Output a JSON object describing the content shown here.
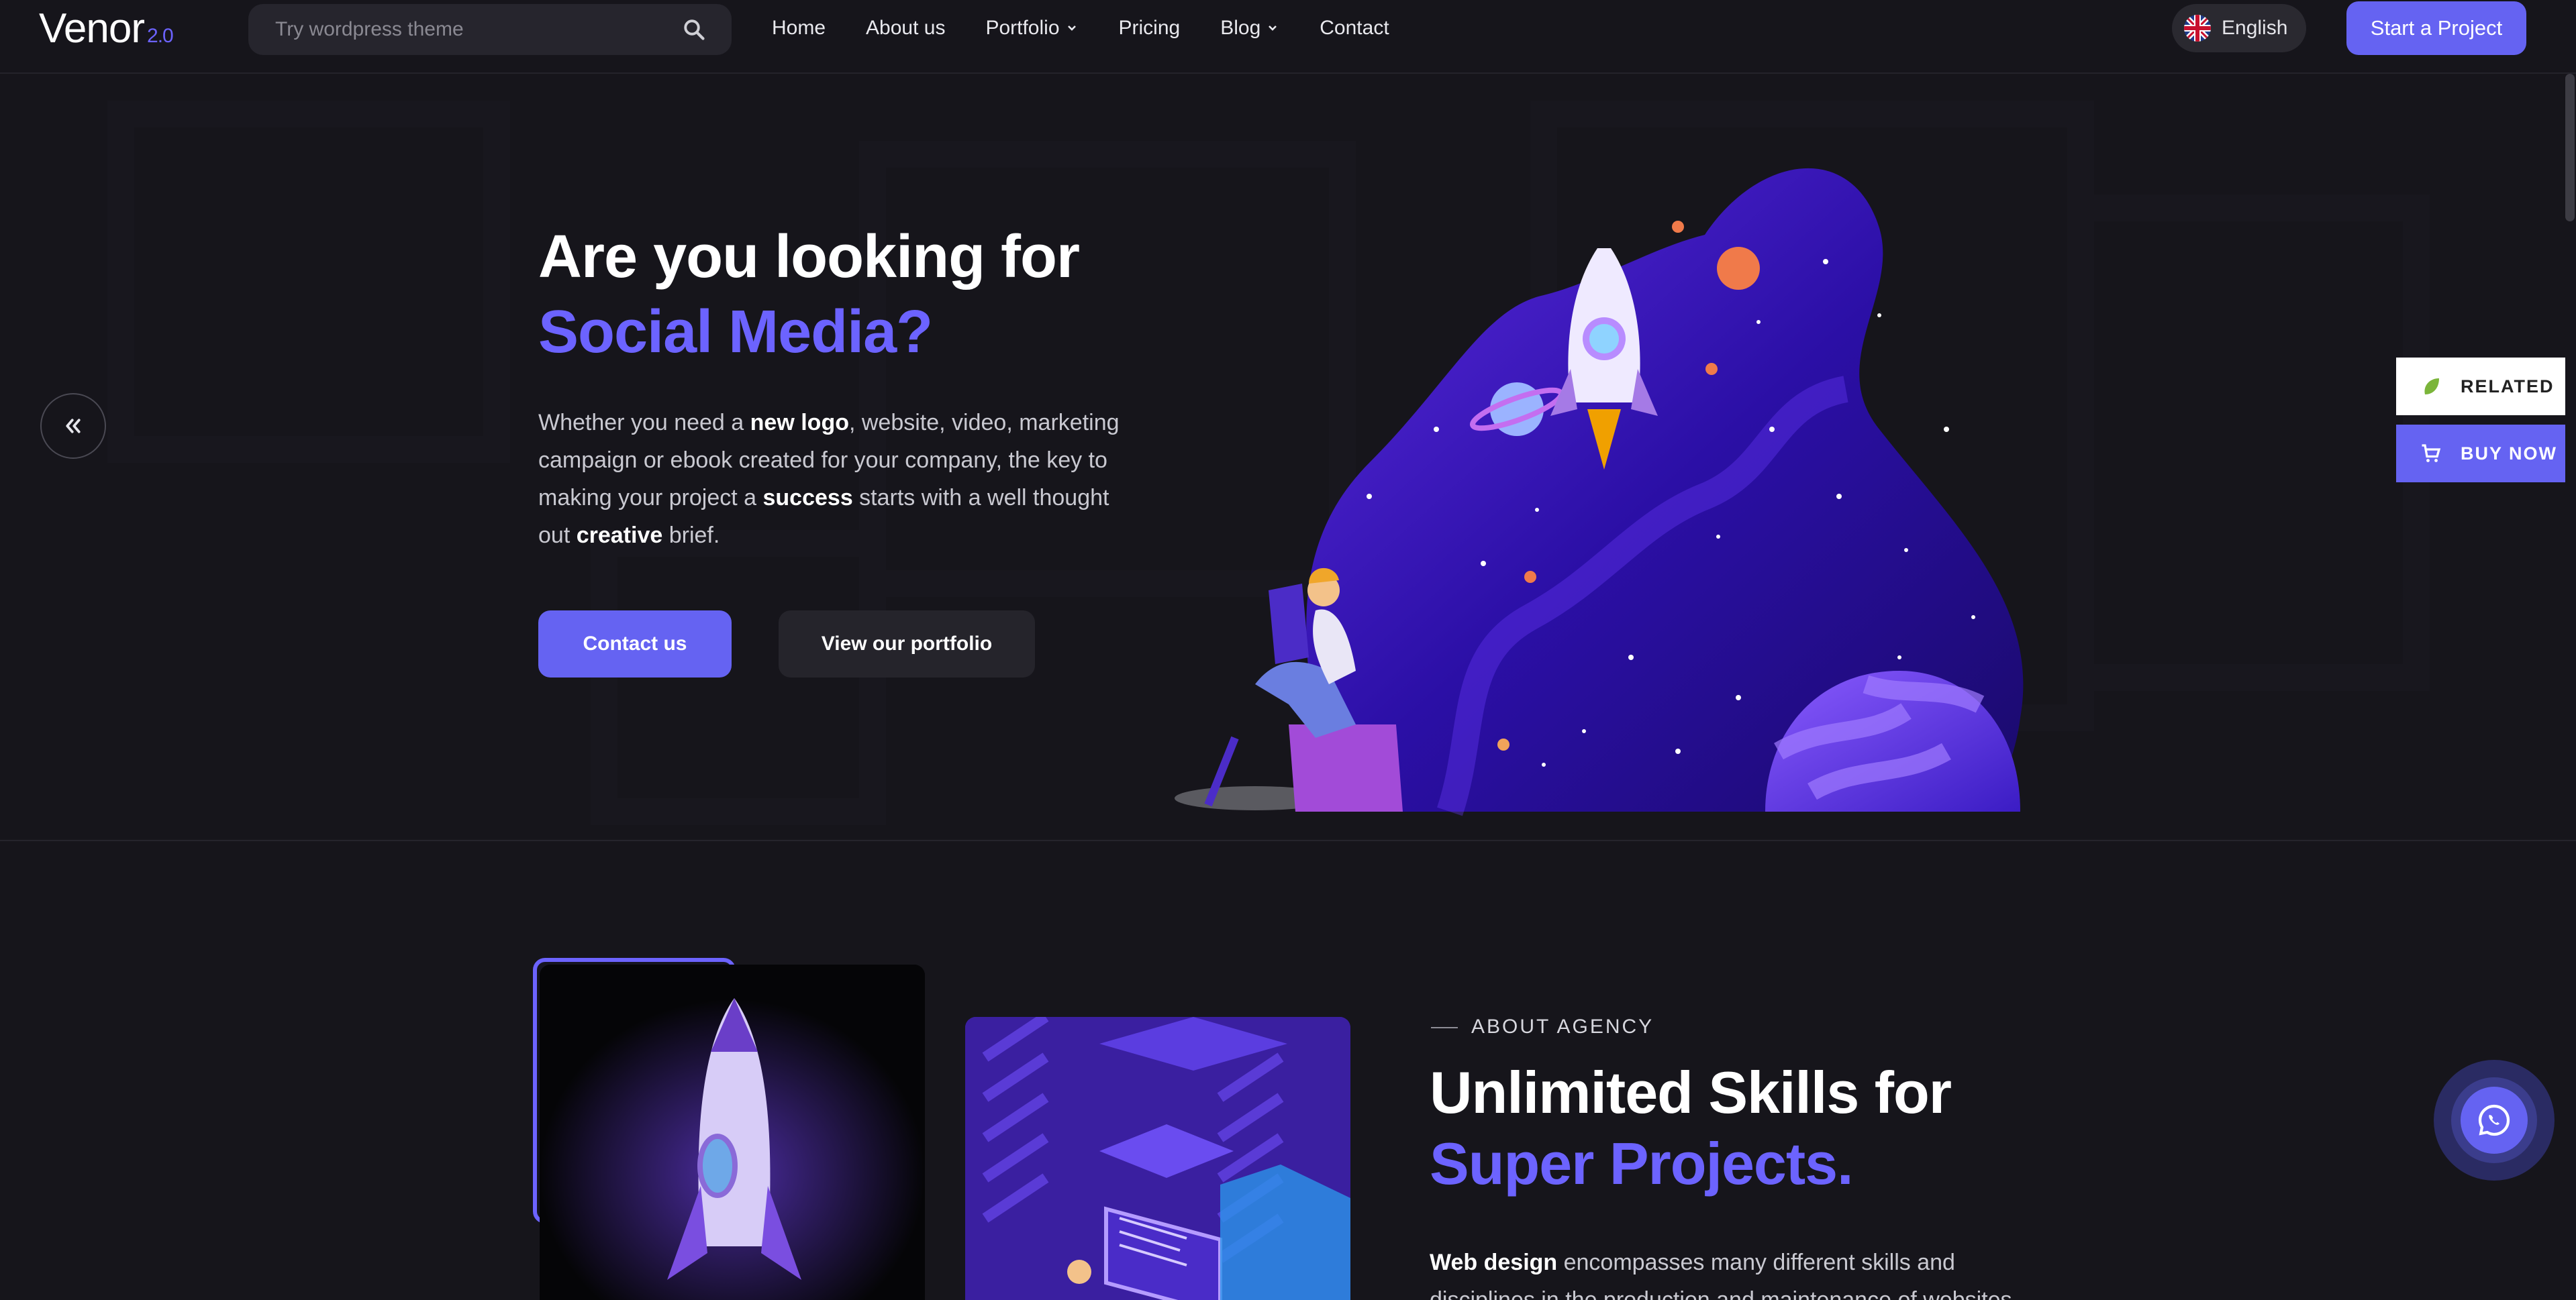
{
  "logo": {
    "name": "Venor",
    "version": "2.0"
  },
  "search": {
    "placeholder": "Try wordpress theme"
  },
  "nav": {
    "items": [
      {
        "label": "Home"
      },
      {
        "label": "About us"
      },
      {
        "label": "Portfolio"
      },
      {
        "label": "Pricing"
      },
      {
        "label": "Blog"
      },
      {
        "label": "Contact"
      }
    ]
  },
  "language": {
    "label": "English"
  },
  "cta": {
    "label": "Start a Project"
  },
  "hero": {
    "title_line1": "Are you looking for",
    "title_line2": "Social Media?",
    "para": {
      "t1": "Whether you need a ",
      "b1": "new logo",
      "t2": ", website, video, marketing campaign or ebook created for your company, the key to making your project a ",
      "b2": "success",
      "t3": " starts with a well thought out ",
      "b3": "creative",
      "t4": " brief."
    },
    "primary_button": "Contact us",
    "secondary_button": "View our portfolio"
  },
  "side": {
    "related": "RELATED",
    "buy_now": "BUY NOW"
  },
  "about": {
    "eyebrow": "ABOUT AGENCY",
    "title_line1": "Unlimited Skills for",
    "title_line2": "Super Projects.",
    "para_bold": "Web design",
    "para_text": " encompasses many different skills and disciplines in the production and maintenance of websites."
  },
  "colors": {
    "accent": "#6563f2",
    "background": "#16151b",
    "highlight": "#6c63ff"
  }
}
